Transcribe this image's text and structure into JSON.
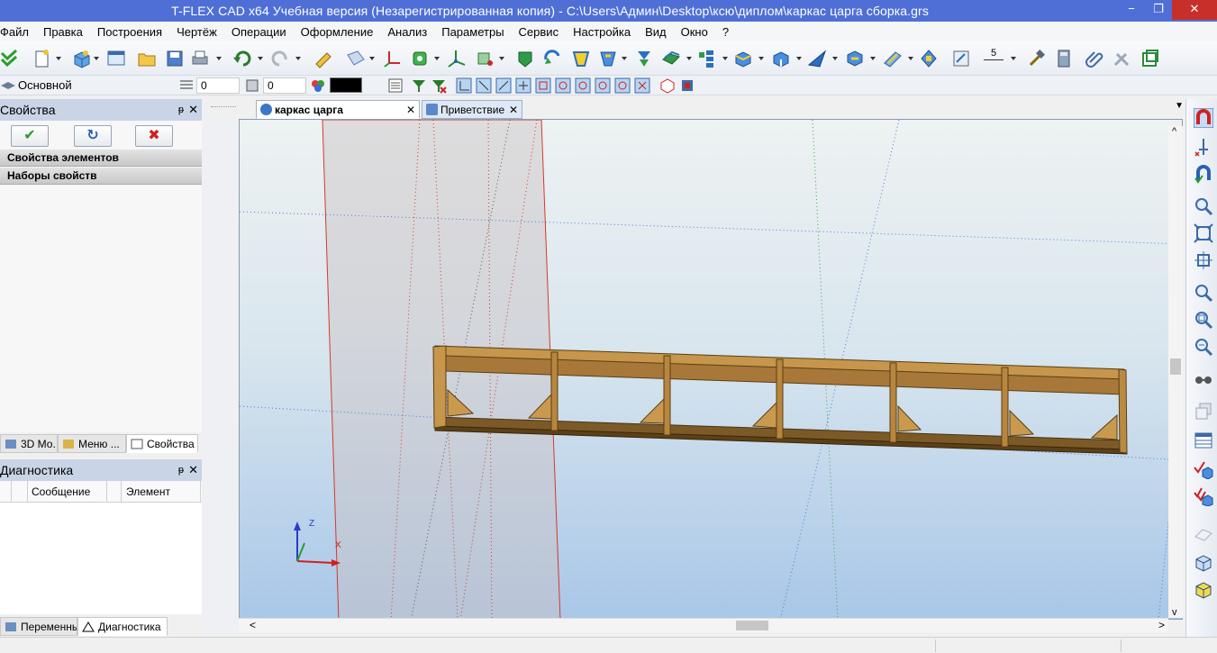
{
  "window": {
    "title": "T-FLEX CAD x64 Учебная версия (Незарегистрированная копия) - C:\\Users\\Админ\\Desktop\\ксю\\диплом\\каркас царга сборка.grs",
    "min_glyph": "−",
    "max_glyph": "❐",
    "close_glyph": "✕"
  },
  "menu": [
    "Файл",
    "Правка",
    "Построения",
    "Чертёж",
    "Операции",
    "Оформление",
    "Анализ",
    "Параметры",
    "Сервис",
    "Настройка",
    "Вид",
    "Окно",
    "?"
  ],
  "toolbar2": {
    "layer_name": "Основной",
    "layer_value": "0",
    "priority_value": "0",
    "color_swatch": "#000000"
  },
  "properties_panel": {
    "title": "Свойства",
    "pin_glyph": "ᵽ",
    "close_glyph": "✕",
    "ok_glyph": "✔",
    "refresh_glyph": "↻",
    "cancel_glyph": "✖",
    "sections": [
      "Свойства элементов",
      "Наборы свойств"
    ],
    "tabs": [
      "3D Мо...",
      "Меню ...",
      "Свойства"
    ]
  },
  "diagnostics_panel": {
    "title": "Диагностика",
    "pin_glyph": "ᵽ",
    "close_glyph": "✕",
    "columns": [
      "Сообщение",
      "Элемент"
    ],
    "tabs": [
      "Переменные",
      "Диагностика"
    ]
  },
  "document_tabs": [
    {
      "label": "каркас царга сборка.grs",
      "active": true,
      "close": "✕"
    },
    {
      "label": "Приветствие",
      "active": false,
      "close": "✕"
    }
  ],
  "viewport": {
    "axis_labels": {
      "z": "Z",
      "x": "X"
    },
    "frame_color": "#9a6f2f",
    "plane_color": "#d43a2b"
  },
  "scroll": {
    "left_arrow": "<",
    "right_arrow": ">",
    "up_arrow": "^",
    "down_arrow": "v"
  },
  "dimension_value": "5",
  "doctabs_dropdown": "▼"
}
